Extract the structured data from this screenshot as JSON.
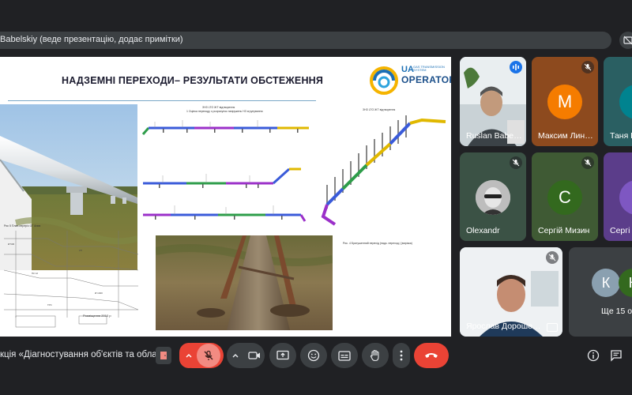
{
  "presenter_bar": {
    "text": "Babelskiy (веде презентацію, додає примітки)"
  },
  "slide": {
    "title": "НАДЗЕМНІ ПЕРЕХОДИ– РЕЗУЛЬТАТИ ОБСТЕЖЕННЯ",
    "logo": {
      "mark": "UA",
      "subtitle": "GAS TRANSMISSION SYSTEM",
      "name": "OPERATOR"
    },
    "caption_scheme": "Рис. 4 Бригушенний перехід (надз. переход.) (вирізка)",
    "caption_drawing": "Рис 5 План-переріз ОГ Анив",
    "caption_photo": "Розміщення 2010 р"
  },
  "participants": [
    {
      "name": "Ruslan Babe…",
      "color": "#5b6a72"
    },
    {
      "name": "Максим Лин…",
      "initial": "М",
      "color": "#8d4a1e",
      "avatar_color": "#f57c00"
    },
    {
      "name": "Таня В",
      "color": "#2a5f62"
    },
    {
      "name": "Olexandr",
      "color": "#3b5245"
    },
    {
      "name": "Сергій Мизин",
      "initial": "С",
      "color": "#3f5a34",
      "avatar_color": "#33691e"
    },
    {
      "name": "Сергі",
      "color": "#5b3d8a"
    },
    {
      "name": "Ярослав Дороше…",
      "color": "#8fa7bd"
    },
    {
      "overflow_label": "Ще 15 ос",
      "initials": [
        "К",
        "К"
      ],
      "color": "#3c4043"
    }
  ],
  "bottom": {
    "meeting_title": "кція «Діагностування об'єктів та облад…"
  },
  "colors": {
    "accent_red": "#ea4335",
    "mic_off": "#f28b82",
    "bg": "#202124"
  }
}
